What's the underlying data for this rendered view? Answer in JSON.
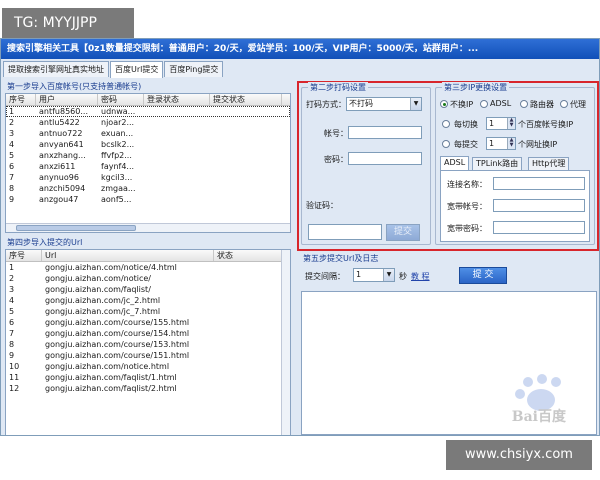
{
  "overlay_tag": "TG: MYYJJPP",
  "watermark": "www.chsiyx.com",
  "window": {
    "title": "搜索引擎相关工具【0z1数量提交限制：普通用户：20/天，爱站学员：100/天，VIP用户：5000/天，站群用户：..."
  },
  "tabs": [
    "提取搜索引擎网址真实地址",
    "百度Url提交",
    "百度Ping提交"
  ],
  "step1": {
    "title": "第一步导入百度帐号(只支持普通帐号)",
    "columns": [
      "序号",
      "用户",
      "密码",
      "登录状态",
      "提交状态"
    ],
    "rows": [
      [
        "1",
        "antfu8560...",
        "udnwa...",
        "",
        ""
      ],
      [
        "2",
        "antlu5422",
        "njoar2...",
        "",
        ""
      ],
      [
        "3",
        "antnuo722",
        "exuan...",
        "",
        ""
      ],
      [
        "4",
        "anvyan641",
        "bcslk2...",
        "",
        ""
      ],
      [
        "5",
        "anxzhang...",
        "ffvfp2...",
        "",
        ""
      ],
      [
        "6",
        "anxzi611",
        "faynf4...",
        "",
        ""
      ],
      [
        "7",
        "anynuo96",
        "kgcil3...",
        "",
        ""
      ],
      [
        "8",
        "anzchi5094",
        "zmgaa...",
        "",
        ""
      ],
      [
        "9",
        "anzgou47",
        "aonf5...",
        "",
        ""
      ]
    ]
  },
  "step2": {
    "title": "第二步打码设置",
    "mode_label": "打码方式：",
    "mode_value": "不打码",
    "account_label": "帐号：",
    "password_label": "密码：",
    "captcha_label": "验证码：",
    "submit_label": "提交"
  },
  "step3": {
    "title": "第三步IP更换设置",
    "radios": [
      "不换IP",
      "ADSL",
      "路由器",
      "代理"
    ],
    "switch1_label": "每切换",
    "switch1_value": "1",
    "switch1_suffix": "个百度帐号换IP",
    "switch2_label": "每提交",
    "switch2_value": "1",
    "switch2_suffix": "个网址换IP",
    "subtabs": [
      "ADSL",
      "TPLink路由",
      "Http代理"
    ],
    "conn_label": "连接名称：",
    "bb_account_label": "宽带帐号：",
    "bb_password_label": "宽带密码："
  },
  "step4": {
    "title": "第四步导入提交的Url",
    "columns": [
      "序号",
      "Url",
      "状态"
    ],
    "rows": [
      [
        "1",
        "gongju.aizhan.com/notice/4.html",
        ""
      ],
      [
        "2",
        "gongju.aizhan.com/notice/",
        ""
      ],
      [
        "3",
        "gongju.aizhan.com/faqlist/",
        ""
      ],
      [
        "4",
        "gongju.aizhan.com/jc_2.html",
        ""
      ],
      [
        "5",
        "gongju.aizhan.com/jc_7.html",
        ""
      ],
      [
        "6",
        "gongju.aizhan.com/course/155.html",
        ""
      ],
      [
        "7",
        "gongju.aizhan.com/course/154.html",
        ""
      ],
      [
        "8",
        "gongju.aizhan.com/course/153.html",
        ""
      ],
      [
        "9",
        "gongju.aizhan.com/course/151.html",
        ""
      ],
      [
        "10",
        "gongju.aizhan.com/notice.html",
        ""
      ],
      [
        "11",
        "gongju.aizhan.com/faqlist/1.html",
        ""
      ],
      [
        "12",
        "gongju.aizhan.com/faqlist/2.html",
        ""
      ]
    ]
  },
  "step5": {
    "title": "第五步提交Url及日志",
    "interval_label": "提交间隔：",
    "interval_value": "1",
    "seconds_label": "秒",
    "tutorial_link": "教 程",
    "submit_label": "提 交"
  },
  "baidu_watermark": "Bai百度"
}
